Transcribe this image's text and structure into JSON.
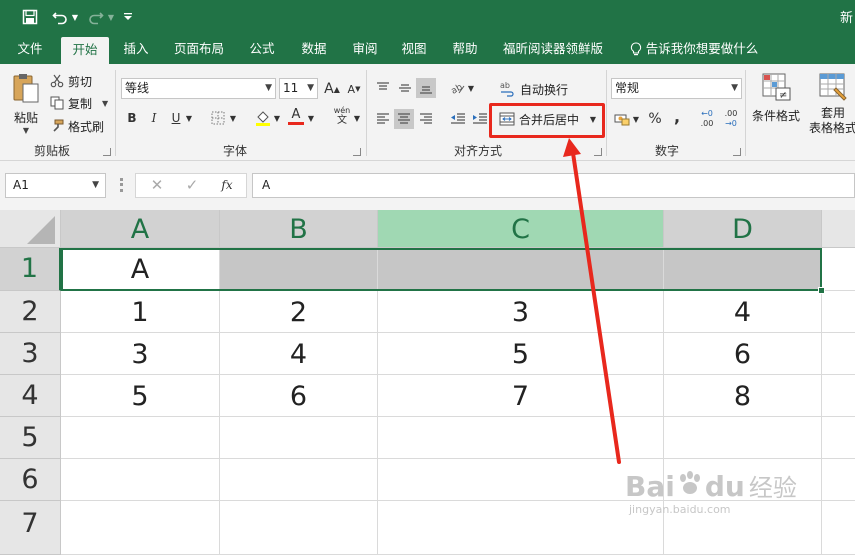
{
  "title_bar": {
    "title": "新",
    "quick_access": [
      "save-icon",
      "undo-icon",
      "redo-icon",
      "customize-icon"
    ]
  },
  "tabs": [
    "文件",
    "开始",
    "插入",
    "页面布局",
    "公式",
    "数据",
    "审阅",
    "视图",
    "帮助",
    "福昕阅读器领鲜版",
    "告诉我你想要做什么"
  ],
  "active_tab": "开始",
  "clipboard": {
    "paste": "粘贴",
    "cut": "剪切",
    "copy": "复制",
    "format_painter": "格式刷",
    "group_label": "剪贴板"
  },
  "font": {
    "font_name": "等线",
    "font_size": "11",
    "bold": "B",
    "italic": "I",
    "underline": "U",
    "grow": "A",
    "shrink": "A",
    "font_color": "A",
    "phonetic_top": "wén",
    "phonetic_bottom": "文",
    "group_label": "字体"
  },
  "alignment": {
    "wrap_text": "自动换行",
    "merge_center": "合并后居中",
    "group_label": "对齐方式"
  },
  "number": {
    "format": "常规",
    "percent": "%",
    "comma": ",",
    "inc_decimal_top": "←0",
    "inc_decimal_bottom": ".00",
    "dec_decimal_top": ".00",
    "dec_decimal_bottom": "→0",
    "group_label": "数字"
  },
  "styles": {
    "conditional": "条件格式",
    "table_top": "套用",
    "table_bottom": "表格格式"
  },
  "formula_bar": {
    "name_box": "A1",
    "fx": "fx",
    "content": "A"
  },
  "grid": {
    "columns": [
      "A",
      "B",
      "C",
      "D"
    ],
    "rows": [
      "1",
      "2",
      "3",
      "4",
      "5",
      "6",
      "7"
    ],
    "cells": [
      [
        "A",
        "",
        "",
        ""
      ],
      [
        "1",
        "2",
        "3",
        "4"
      ],
      [
        "3",
        "4",
        "5",
        "6"
      ],
      [
        "5",
        "6",
        "7",
        "8"
      ],
      [
        "",
        "",
        "",
        ""
      ],
      [
        "",
        "",
        "",
        ""
      ],
      [
        "",
        "",
        "",
        ""
      ]
    ]
  },
  "colors": {
    "excel_green": "#217346",
    "highlight_red": "#e8281d",
    "selected_header": "#a0d8b3"
  },
  "watermark": {
    "brand": "Bai",
    "paw": "du",
    "label": "经验",
    "url": "jingyan.baidu.com"
  }
}
